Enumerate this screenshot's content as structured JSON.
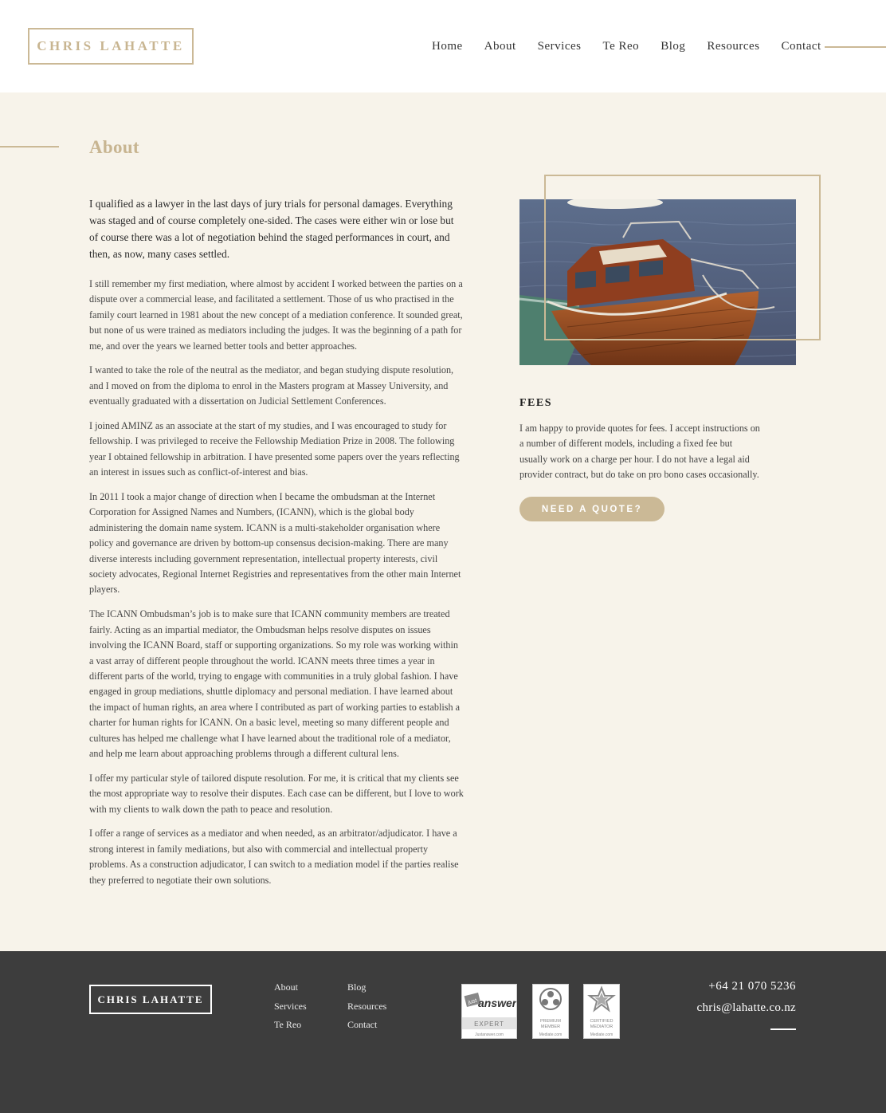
{
  "header": {
    "logo": "CHRIS LAHATTE",
    "nav": [
      "Home",
      "About",
      "Services",
      "Te Reo",
      "Blog",
      "Resources",
      "Contact"
    ]
  },
  "page_title": "About",
  "lead": "I qualified as a lawyer in the last days of jury trials for personal damages. Everything was staged and of course completely one-sided. The cases were either win or lose but of course there was a lot of negotiation behind the staged performances in court, and then, as now, many cases settled.",
  "paragraphs": [
    "I still remember my first mediation, where almost by accident I worked between the parties on a dispute over a commercial lease, and facilitated a settlement. Those of us who practised in the family court learned in 1981 about the new concept of a mediation conference. It sounded great, but none of us were trained as mediators including the judges. It was the beginning of a path for me, and over the years we learned better tools and better approaches.",
    "I wanted to take the role of the neutral as the mediator, and began studying dispute resolution, and I moved on from the diploma to enrol in the Masters program at Massey University, and eventually graduated with a dissertation on Judicial Settlement Conferences.",
    "I joined AMINZ as an associate at the start of my studies, and I was encouraged to study for fellowship. I was privileged to receive the Fellowship Mediation Prize in 2008. The following year I obtained fellowship in arbitration. I have presented some papers over the years reflecting an interest in issues such as conflict-of-interest and bias.",
    "In 2011 I took a major change of direction when I became the ombudsman at the Internet Corporation for Assigned Names and Numbers, (ICANN), which is the global body administering the domain name system. ICANN is a multi-stakeholder organisation where policy and governance are driven by bottom-up consensus decision-making. There are many diverse interests including government representation, intellectual property interests, civil society advocates, Regional Internet Registries and representatives from the other main Internet players.",
    "The ICANN Ombudsman’s job is to make sure that ICANN community members are treated fairly. Acting as an impartial mediator, the Ombudsman helps resolve disputes on issues involving the ICANN Board, staff or supporting organizations. So my role was working within a vast array of different people throughout the world. ICANN meets three times a year in different parts of the world, trying to engage with communities in a truly global fashion. I have engaged in group mediations, shuttle diplomacy and personal mediation. I have learned about the impact of human rights, an area where I contributed as part of working parties to establish a charter for human rights for ICANN. On a basic level, meeting so many different people and cultures has helped me challenge what I have learned about the traditional role of a mediator, and help me learn about approaching problems through a different cultural lens.",
    "I offer my particular style of tailored dispute resolution. For me, it is critical that my clients see the most appropriate way to resolve their disputes. Each case can be different, but I love to work with my clients to walk down the path to peace and resolution.",
    "I offer a range of services as a mediator and when needed, as an arbitrator/adjudicator. I have a strong interest in family mediations, but also with commercial and intellectual property problems. As a construction adjudicator, I can switch to a mediation model if the parties realise they preferred to negotiate their own solutions."
  ],
  "fees": {
    "title": "FEES",
    "text": "I am happy to provide quotes for fees. I accept instructions on a number of different models, including a fixed fee but usually work on a charge per hour. I do not have a legal aid provider contract, but do take on pro bono cases occasionally.",
    "button": "NEED A QUOTE?"
  },
  "footer": {
    "logo": "CHRIS LAHATTE",
    "col1": [
      "About",
      "Services",
      "Te Reo"
    ],
    "col2": [
      "Blog",
      "Resources",
      "Contact"
    ],
    "badges": {
      "justanswer": {
        "brand_small": "just",
        "brand": "answer",
        "label": "EXPERT",
        "url": "Justanswer.com"
      },
      "premium": {
        "line1": "PREMIUM",
        "line2": "MEMBER",
        "url": "Mediate.com"
      },
      "certified": {
        "line1": "CERTIFIED",
        "line2": "MEDIATOR",
        "url": "Mediate.com"
      }
    },
    "phone": "+64 21 070 5236",
    "email": "chris@lahatte.co.nz"
  },
  "colors": {
    "accent": "#cbb996",
    "background": "#f7f3ea",
    "footer": "#3d3d3d"
  }
}
